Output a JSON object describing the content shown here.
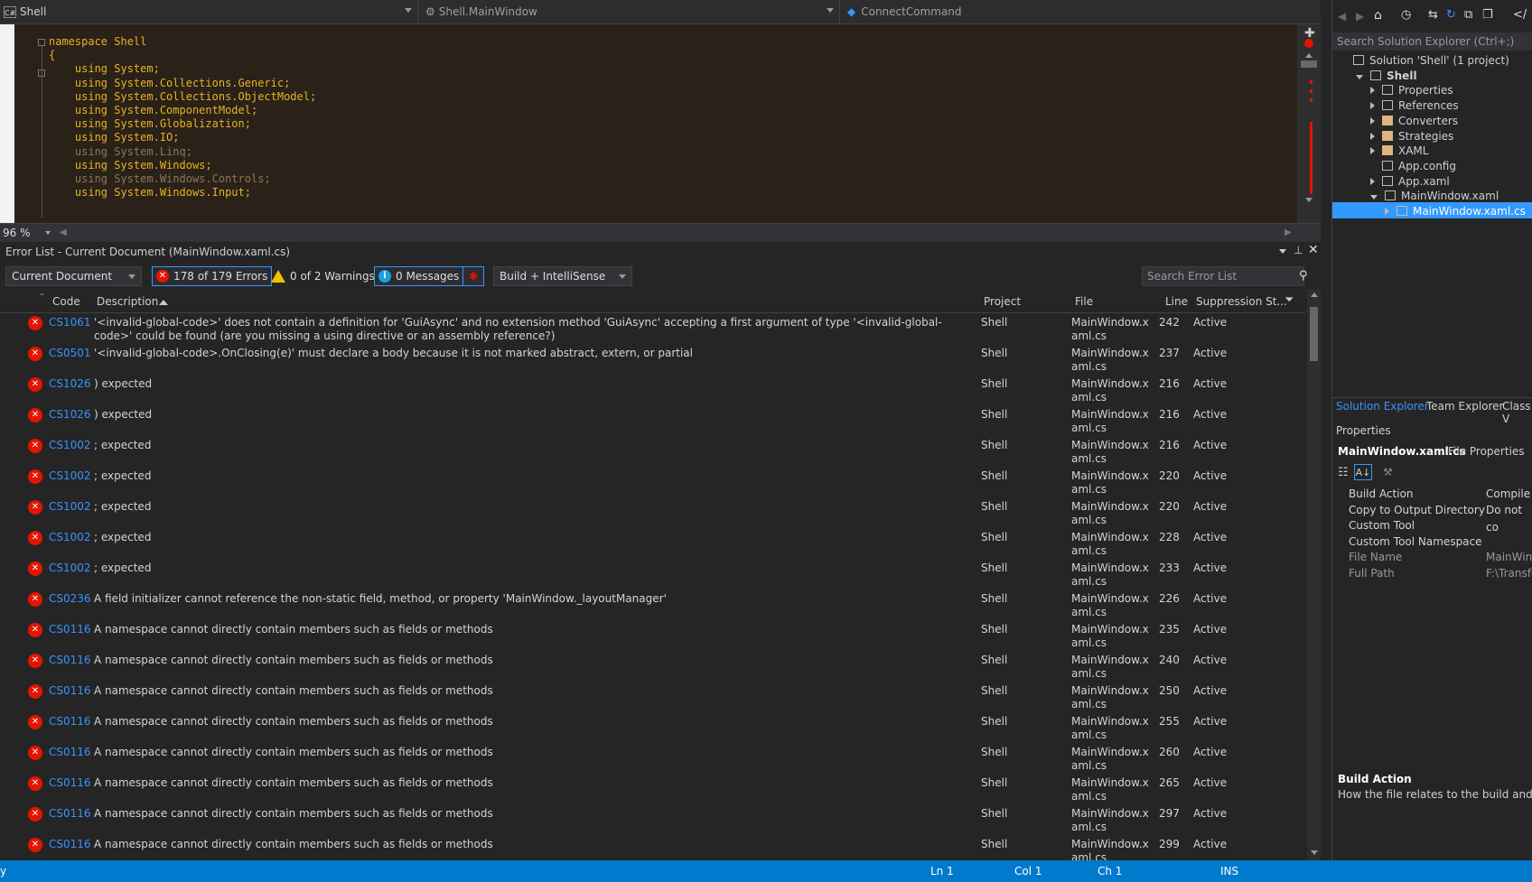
{
  "nav": {
    "project": "Shell",
    "project_badge": "C#",
    "class": "Shell.MainWindow",
    "member": "ConnectCommand"
  },
  "editor": {
    "lines": [
      {
        "text": "namespace Shell",
        "style": "mixed_ns"
      },
      {
        "text": "{",
        "style": "plain"
      },
      {
        "text": "    using System;",
        "style": "kw"
      },
      {
        "text": "    using System.Collections.Generic;",
        "style": "kw"
      },
      {
        "text": "    using System.Collections.ObjectModel;",
        "style": "kw"
      },
      {
        "text": "    using System.ComponentModel;",
        "style": "kw"
      },
      {
        "text": "    using System.Globalization;",
        "style": "kw"
      },
      {
        "text": "    using System.IO;",
        "style": "kw"
      },
      {
        "text": "    using System.Linq;",
        "style": "dim"
      },
      {
        "text": "    using System.Windows;",
        "style": "kw"
      },
      {
        "text": "    using System.Windows.Controls;",
        "style": "dim"
      },
      {
        "text": "    using System.Windows.Input;",
        "style": "kw"
      }
    ],
    "zoom": "96 %"
  },
  "error_list": {
    "title": "Error List - Current Document (MainWindow.xaml.cs)",
    "scope": "Current Document",
    "errors_filter": "178 of 179 Errors",
    "warnings_filter": "0 of 2 Warnings",
    "messages_filter": "0 Messages",
    "build_source": "Build + IntelliSense",
    "search_placeholder": "Search Error List",
    "columns": {
      "code": "Code",
      "description": "Description",
      "project": "Project",
      "file": "File",
      "line": "Line",
      "suppression": "Suppression St..."
    },
    "rows": [
      {
        "code": "CS1061",
        "desc": "'<invalid-global-code>' does not contain a definition for 'GuiAsync' and no extension method 'GuiAsync' accepting a first argument of type '<invalid-global-code>' could be found (are you missing a using directive or an assembly reference?)",
        "project": "Shell",
        "file": "MainWindow.xaml.cs",
        "line": "242",
        "state": "Active"
      },
      {
        "code": "CS0501",
        "desc": "'<invalid-global-code>.OnClosing(e)' must declare a body because it is not marked abstract, extern, or partial",
        "project": "Shell",
        "file": "MainWindow.xaml.cs",
        "line": "237",
        "state": "Active"
      },
      {
        "code": "CS1026",
        "desc": ") expected",
        "project": "Shell",
        "file": "MainWindow.xaml.cs",
        "line": "216",
        "state": "Active"
      },
      {
        "code": "CS1026",
        "desc": ") expected",
        "project": "Shell",
        "file": "MainWindow.xaml.cs",
        "line": "216",
        "state": "Active"
      },
      {
        "code": "CS1002",
        "desc": "; expected",
        "project": "Shell",
        "file": "MainWindow.xaml.cs",
        "line": "216",
        "state": "Active"
      },
      {
        "code": "CS1002",
        "desc": "; expected",
        "project": "Shell",
        "file": "MainWindow.xaml.cs",
        "line": "220",
        "state": "Active"
      },
      {
        "code": "CS1002",
        "desc": "; expected",
        "project": "Shell",
        "file": "MainWindow.xaml.cs",
        "line": "220",
        "state": "Active"
      },
      {
        "code": "CS1002",
        "desc": "; expected",
        "project": "Shell",
        "file": "MainWindow.xaml.cs",
        "line": "228",
        "state": "Active"
      },
      {
        "code": "CS1002",
        "desc": "; expected",
        "project": "Shell",
        "file": "MainWindow.xaml.cs",
        "line": "233",
        "state": "Active"
      },
      {
        "code": "CS0236",
        "desc": "A field initializer cannot reference the non-static field, method, or property 'MainWindow._layoutManager'",
        "project": "Shell",
        "file": "MainWindow.xaml.cs",
        "line": "226",
        "state": "Active"
      },
      {
        "code": "CS0116",
        "desc": "A namespace cannot directly contain members such as fields or methods",
        "project": "Shell",
        "file": "MainWindow.xaml.cs",
        "line": "235",
        "state": "Active"
      },
      {
        "code": "CS0116",
        "desc": "A namespace cannot directly contain members such as fields or methods",
        "project": "Shell",
        "file": "MainWindow.xaml.cs",
        "line": "240",
        "state": "Active"
      },
      {
        "code": "CS0116",
        "desc": "A namespace cannot directly contain members such as fields or methods",
        "project": "Shell",
        "file": "MainWindow.xaml.cs",
        "line": "250",
        "state": "Active"
      },
      {
        "code": "CS0116",
        "desc": "A namespace cannot directly contain members such as fields or methods",
        "project": "Shell",
        "file": "MainWindow.xaml.cs",
        "line": "255",
        "state": "Active"
      },
      {
        "code": "CS0116",
        "desc": "A namespace cannot directly contain members such as fields or methods",
        "project": "Shell",
        "file": "MainWindow.xaml.cs",
        "line": "260",
        "state": "Active"
      },
      {
        "code": "CS0116",
        "desc": "A namespace cannot directly contain members such as fields or methods",
        "project": "Shell",
        "file": "MainWindow.xaml.cs",
        "line": "265",
        "state": "Active"
      },
      {
        "code": "CS0116",
        "desc": "A namespace cannot directly contain members such as fields or methods",
        "project": "Shell",
        "file": "MainWindow.xaml.cs",
        "line": "297",
        "state": "Active"
      },
      {
        "code": "CS0116",
        "desc": "A namespace cannot directly contain members such as fields or methods",
        "project": "Shell",
        "file": "MainWindow.xaml.cs",
        "line": "299",
        "state": "Active"
      }
    ]
  },
  "solution_explorer": {
    "search_placeholder": "Search Solution Explorer (Ctrl+;)",
    "items": [
      {
        "label": "Solution 'Shell' (1 project)",
        "level": 0,
        "icon": "solution-icon",
        "expander": "none"
      },
      {
        "label": "Shell",
        "level": 1,
        "icon": "csharp-project-icon",
        "expander": "open",
        "bold": true
      },
      {
        "label": "Properties",
        "level": 2,
        "icon": "wrench-icon",
        "expander": "closed"
      },
      {
        "label": "References",
        "level": 2,
        "icon": "references-icon",
        "expander": "closed"
      },
      {
        "label": "Converters",
        "level": 2,
        "icon": "folder-icon",
        "expander": "closed"
      },
      {
        "label": "Strategies",
        "level": 2,
        "icon": "folder-icon",
        "expander": "closed"
      },
      {
        "label": "XAML",
        "level": 2,
        "icon": "folder-icon",
        "expander": "closed"
      },
      {
        "label": "App.config",
        "level": 2,
        "icon": "config-file-icon",
        "expander": "none"
      },
      {
        "label": "App.xaml",
        "level": 2,
        "icon": "xaml-file-icon",
        "expander": "closed"
      },
      {
        "label": "MainWindow.xaml",
        "level": 2,
        "icon": "xaml-file-icon",
        "expander": "open"
      },
      {
        "label": "MainWindow.xaml.cs",
        "level": 3,
        "icon": "cs-file-icon",
        "expander": "closed",
        "selected": true
      }
    ],
    "tabs": [
      "Solution Explorer",
      "Team Explorer",
      "Class V"
    ]
  },
  "properties": {
    "title": "Properties",
    "object": "MainWindow.xaml.cs",
    "object_type": "File Properties",
    "rows": [
      {
        "name": "Build Action",
        "value": "Compile"
      },
      {
        "name": "Copy to Output Directory",
        "value": "Do not co"
      },
      {
        "name": "Custom Tool",
        "value": ""
      },
      {
        "name": "Custom Tool Namespace",
        "value": ""
      },
      {
        "name": "File Name",
        "value": "MainWind"
      },
      {
        "name": "Full Path",
        "value": "F:\\Transfe"
      }
    ],
    "desc_title": "Build Action",
    "desc_text": "How the file relates to the build and deplo"
  },
  "status": {
    "left": "y",
    "ln": "Ln 1",
    "col": "Col 1",
    "ch": "Ch 1",
    "mode": "INS",
    "color": "#007acc"
  }
}
